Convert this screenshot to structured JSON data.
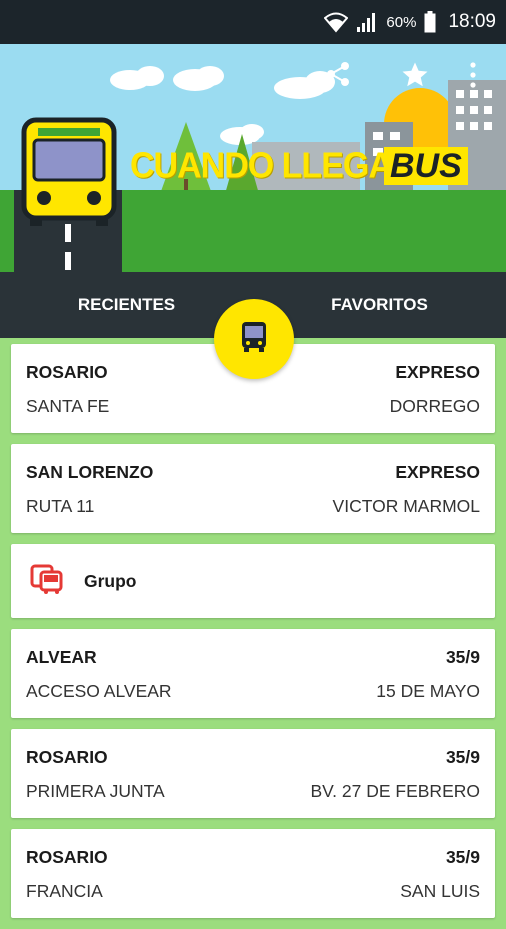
{
  "status_bar": {
    "battery": "60%",
    "time": "18:09"
  },
  "app": {
    "brand_text": "CUANDO LLEGA",
    "brand_bus": "BUS"
  },
  "tabs": [
    {
      "label": "RECIENTES"
    },
    {
      "label": "FAVORITOS"
    }
  ],
  "routes": [
    {
      "city": "ROSARIO",
      "line": "EXPRESO",
      "from": "SANTA FE",
      "to": "DORREGO"
    },
    {
      "city": "SAN LORENZO",
      "line": "EXPRESO",
      "from": "RUTA 11",
      "to": "VICTOR MARMOL"
    }
  ],
  "group": {
    "label": "Grupo"
  },
  "routes_more": [
    {
      "city": "ALVEAR",
      "line": "35/9",
      "from": "ACCESO ALVEAR",
      "to": "15 DE MAYO"
    },
    {
      "city": "ROSARIO",
      "line": "35/9",
      "from": "PRIMERA JUNTA",
      "to": "BV. 27 DE FEBRERO"
    },
    {
      "city": "ROSARIO",
      "line": "35/9",
      "from": "FRANCIA",
      "to": "SAN LUIS"
    }
  ],
  "colors": {
    "accent": "#ffe600",
    "background": "#9bdd7e",
    "tabs": "#2a3338",
    "group_icon": "#e53935"
  }
}
